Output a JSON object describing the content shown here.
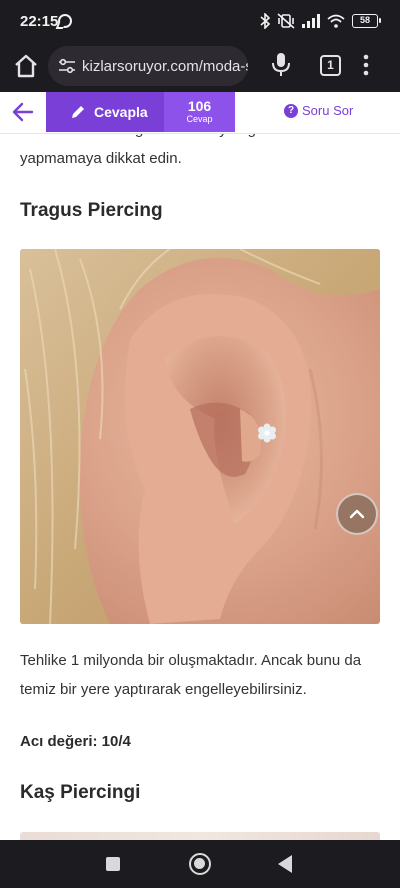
{
  "status": {
    "time": "22:15",
    "battery": "58",
    "icons": [
      "whatsapp-icon",
      "bluetooth-icon",
      "vibrate-off-icon",
      "signal-icon",
      "wifi-icon",
      "battery-icon"
    ]
  },
  "browser": {
    "url": "kizlarsoruyor.com/moda-s",
    "tab_count": "1",
    "icons": [
      "home-icon",
      "tune-icon",
      "mic-icon",
      "tabs-icon",
      "menu-icon"
    ]
  },
  "site_bar": {
    "answer_label": "Cevapla",
    "answer_count": "106",
    "answer_count_label": "Cevap",
    "ask_label": "Soru Sor",
    "accent": "#7a3fd6",
    "icons": [
      "back-arrow-icon",
      "pencil-icon",
      "question-icon"
    ]
  },
  "article": {
    "intro_clipped": "İlk helix deldireceğiniz zaman yattığınız tarafa yapmamaya dikkat edin.",
    "tragus_heading": "Tragus Piercing",
    "tragus_text": "Tehlike 1 milyonda bir oluşmaktadır. Ancak bunu da temiz bir yere yaptırarak engelleyebilirsiniz.",
    "pain_value": "Acı değeri: 10/4",
    "kas_heading": "Kaş Piercingi"
  },
  "nav": {
    "icons": [
      "recents-icon",
      "home-circle-icon",
      "back-triangle-icon"
    ]
  }
}
